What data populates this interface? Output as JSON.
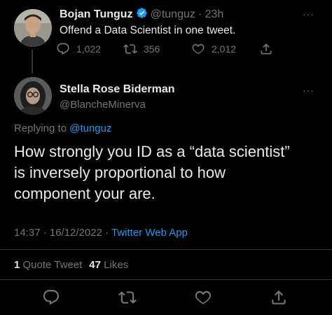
{
  "parent_tweet": {
    "display_name": "Bojan Tunguz",
    "handle": "@tunguz",
    "time": "· 23h",
    "text": "Offend a Data Scientist in one tweet.",
    "replies": "1,022",
    "retweets": "356",
    "likes": "2,012",
    "more": "···",
    "icons": [
      "reply-icon",
      "retweet-icon",
      "like-icon",
      "share-icon",
      "verified-badge-icon"
    ]
  },
  "main_tweet": {
    "display_name": "Stella Rose Biderman",
    "handle": "@BlancheMinerva",
    "replying_prefix": "Replying to",
    "replying_to": "@tunguz",
    "text_lines": [
      "How strongly you ID as a “data scientist”",
      "is inversely proportional to how",
      "component your are."
    ],
    "timestamp": "14:37 · 16/12/2022 · ",
    "source": "Twitter Web App",
    "quote_count": "1",
    "quote_label": "Quote Tweet",
    "like_count": "47",
    "like_label": "Likes",
    "more": "···"
  },
  "colors": {
    "background": "#000000",
    "text": "#e7e9ea",
    "secondary": "#71767b",
    "accent": "#1d9bf0",
    "divider": "#2f3336"
  }
}
